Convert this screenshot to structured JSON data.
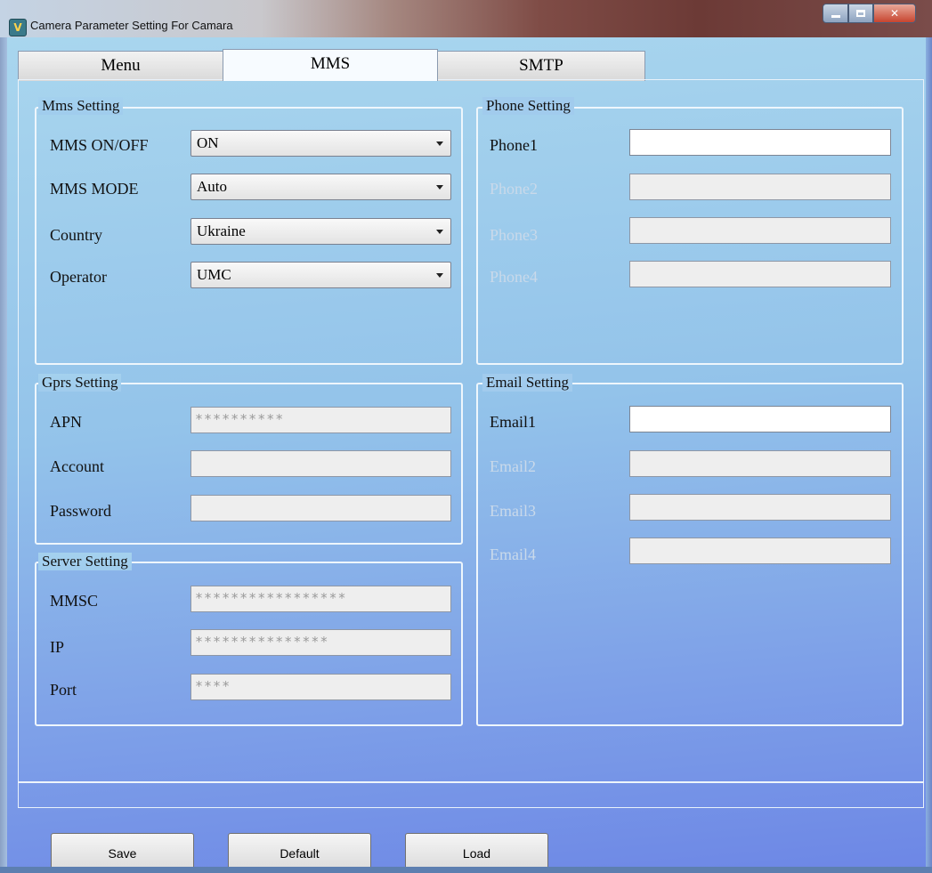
{
  "window": {
    "title": "Camera Parameter Setting For  Camara",
    "icon": "app-icon"
  },
  "tabs": [
    {
      "label": "Menu",
      "active": false
    },
    {
      "label": "MMS",
      "active": true
    },
    {
      "label": "SMTP",
      "active": false
    }
  ],
  "mms_setting": {
    "legend": "Mms Setting",
    "rows": [
      {
        "label": "MMS ON/OFF",
        "value": "ON"
      },
      {
        "label": "MMS MODE",
        "value": "Auto"
      },
      {
        "label": "Country",
        "value": "Ukraine"
      },
      {
        "label": "Operator",
        "value": "UMC"
      }
    ]
  },
  "gprs_setting": {
    "legend": "Gprs Setting",
    "rows": [
      {
        "label": "APN",
        "value": "**********"
      },
      {
        "label": "Account",
        "value": ""
      },
      {
        "label": "Password",
        "value": ""
      }
    ]
  },
  "server_setting": {
    "legend": "Server Setting",
    "rows": [
      {
        "label": "MMSC",
        "value": "*****************"
      },
      {
        "label": "IP",
        "value": "***************"
      },
      {
        "label": "Port",
        "value": "****"
      }
    ]
  },
  "phone_setting": {
    "legend": "Phone Setting",
    "rows": [
      {
        "label": "Phone1",
        "value": "",
        "enabled": true
      },
      {
        "label": "Phone2",
        "value": "",
        "enabled": false
      },
      {
        "label": "Phone3",
        "value": "",
        "enabled": false
      },
      {
        "label": "Phone4",
        "value": "",
        "enabled": false
      }
    ]
  },
  "email_setting": {
    "legend": "Email Setting",
    "rows": [
      {
        "label": "Email1",
        "value": "",
        "enabled": true
      },
      {
        "label": "Email2",
        "value": "",
        "enabled": false
      },
      {
        "label": "Email3",
        "value": "",
        "enabled": false
      },
      {
        "label": "Email4",
        "value": "",
        "enabled": false
      }
    ]
  },
  "buttons": {
    "save": "Save",
    "default": "Default",
    "load": "Load"
  },
  "colors": {
    "panel_gradient_top": "#a9d6ee",
    "panel_gradient_bottom": "#6d87e6",
    "disabled_label": "#c9d9ea"
  }
}
